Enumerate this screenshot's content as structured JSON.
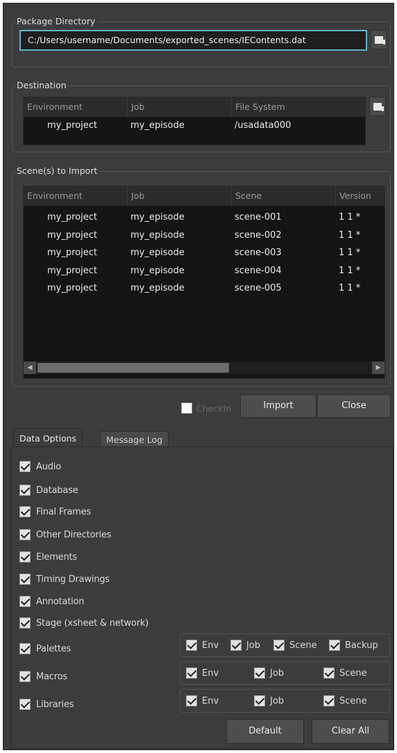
{
  "package_directory": {
    "title": "Package Directory",
    "path_value": "C:/Users/username/Documents/exported_scenes/IEContents.dat",
    "browse_icon": "folder-browse-icon"
  },
  "destination": {
    "title": "Destination",
    "columns": [
      "Environment",
      "Job",
      "File System"
    ],
    "rows": [
      [
        "my_project",
        "my_episode",
        "/usadata000"
      ]
    ],
    "browse_icon": "folder-browse-icon"
  },
  "scenes": {
    "title": "Scene(s) to Import",
    "columns": [
      "Environment",
      "Job",
      "Scene",
      "Version"
    ],
    "rows": [
      [
        "my_project",
        "my_episode",
        "scene-001",
        "1 1 *"
      ],
      [
        "my_project",
        "my_episode",
        "scene-002",
        "1 1 *"
      ],
      [
        "my_project",
        "my_episode",
        "scene-003",
        "1 1 *"
      ],
      [
        "my_project",
        "my_episode",
        "scene-004",
        "1 1 *"
      ],
      [
        "my_project",
        "my_episode",
        "scene-005",
        "1 1 *"
      ]
    ]
  },
  "actions": {
    "checkin_label": "CheckIn",
    "checkin_checked": false,
    "import_label": "Import",
    "close_label": "Close"
  },
  "tabs": [
    {
      "label": "Data Options",
      "active": true
    },
    {
      "label": "Message Log",
      "active": false
    }
  ],
  "data_options": [
    {
      "label": "Audio",
      "checked": true
    },
    {
      "label": "Database",
      "checked": true
    },
    {
      "label": "Final Frames",
      "checked": true
    },
    {
      "label": "Other Directories",
      "checked": true
    },
    {
      "label": "Elements",
      "checked": true
    },
    {
      "label": "Timing Drawings",
      "checked": true
    },
    {
      "label": "Annotation",
      "checked": true
    },
    {
      "label": "Stage (xsheet & network)",
      "checked": true
    },
    {
      "label": "Palettes",
      "checked": true
    },
    {
      "label": "Macros",
      "checked": true
    },
    {
      "label": "Libraries",
      "checked": true
    }
  ],
  "palettes_scope": {
    "env": "Env",
    "job": "Job",
    "scene": "Scene",
    "backup": "Backup"
  },
  "macros_scope": {
    "env": "Env",
    "job": "Job",
    "scene": "Scene"
  },
  "libraries_scope": {
    "env": "Env",
    "job": "Job",
    "scene": "Scene"
  },
  "footer": {
    "default_label": "Default",
    "clear_all_label": "Clear All"
  },
  "colors": {
    "panel_bg": "#3c3c3c",
    "table_bg": "#141414",
    "input_focus_border": "#5fb3c9"
  }
}
